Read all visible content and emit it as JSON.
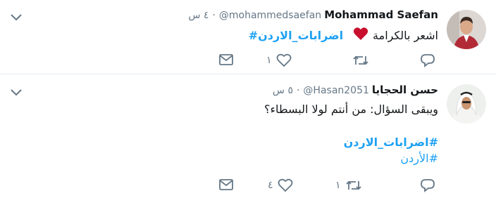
{
  "tweets": [
    {
      "name": "Mohammad Saefan",
      "handle": "@mohammedsaefan",
      "time": "٤ س",
      "dot": "·",
      "text_before": "اشعر بالكرامة",
      "hashtag": "#اضرابات_الاردن",
      "heart_color": "#e0245e",
      "counts": {
        "reply": "",
        "retweet": "",
        "like": "١",
        "dm": ""
      }
    },
    {
      "name": "حسن الحجايا",
      "handle": "@Hasan2051",
      "time": "٥ س",
      "dot": "·",
      "line1": "ويبقى السؤال: من أنتم لولا البسطاء؟",
      "hashtag1": "#اضرابات_الاردن",
      "hashtag2": "#الأردن",
      "counts": {
        "reply": "",
        "retweet": "١",
        "like": "٤",
        "dm": ""
      }
    }
  ],
  "colors": {
    "link": "#1da1f2",
    "muted": "#657786",
    "divider": "#e6ecf0"
  },
  "icons": [
    "chevron-down-icon",
    "reply-icon",
    "retweet-icon",
    "like-icon",
    "dm-icon",
    "heart-emoji-icon"
  ]
}
